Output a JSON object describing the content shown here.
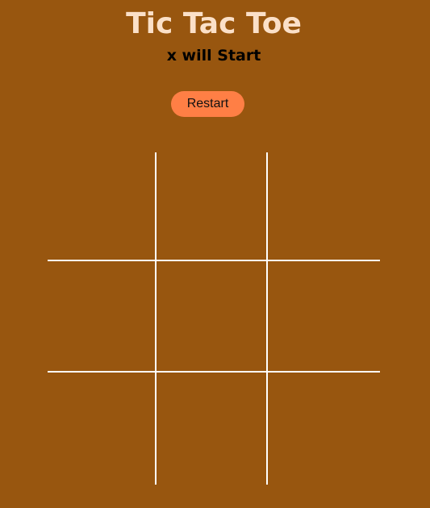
{
  "game": {
    "title": "Tic Tac Toe",
    "status": "x will Start",
    "restart_label": "Restart",
    "cells": [
      "",
      "",
      "",
      "",
      "",
      "",
      "",
      "",
      ""
    ]
  },
  "colors": {
    "background": "#98560f",
    "title": "#fbe0c8",
    "button": "#ff7f45",
    "grid_lines": "#ffffff"
  }
}
